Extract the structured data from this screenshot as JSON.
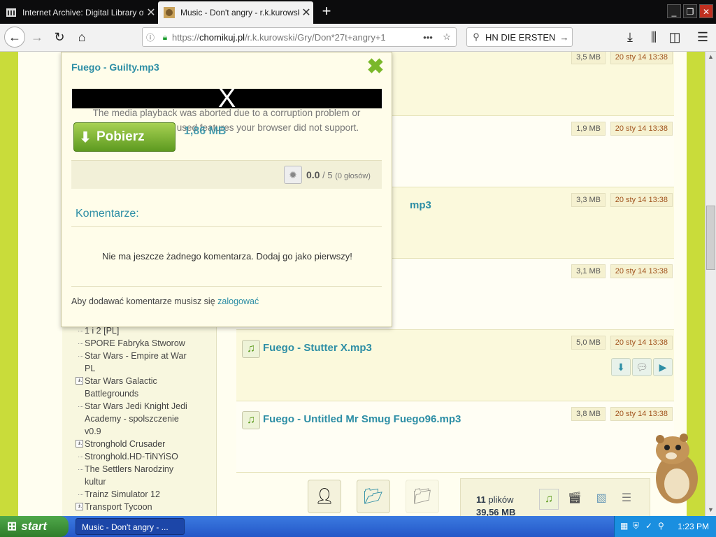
{
  "browser": {
    "tabs": [
      {
        "title": "Internet Archive: Digital Library of",
        "active": false
      },
      {
        "title": "Music - Don't angry - r.k.kurowski",
        "active": true
      }
    ],
    "new_tab": "+",
    "window_controls": {
      "minimize": "_",
      "restore": "❐",
      "close": "✕"
    },
    "url_domain": "chomikuj.pl",
    "url_rest": "/r.k.kurowski/Gry/Don*27t+angry+1",
    "url_prefix": "https://",
    "search_text": "HN DIE ERSTEN"
  },
  "files": [
    {
      "name": "",
      "size": "3,5 MB",
      "date": "20 sty 14 13:38"
    },
    {
      "name": "",
      "size": "1,9 MB",
      "date": "20 sty 14 13:38"
    },
    {
      "name": "mp3",
      "size": "3,3 MB",
      "date": "20 sty 14 13:38"
    },
    {
      "name": "",
      "size": "3,1 MB",
      "date": "20 sty 14 13:38"
    },
    {
      "name": "Fuego - Stutter X.mp3",
      "size": "5,0 MB",
      "date": "20 sty 14 13:38"
    },
    {
      "name": "Fuego - Untitled Mr Smug Fuego96.mp3",
      "size": "3,8 MB",
      "date": "20 sty 14 13:38"
    }
  ],
  "tree": [
    {
      "label": "1 i 2 [PL]",
      "plus": false
    },
    {
      "label": "SPORE Fabryka Stworow",
      "plus": false
    },
    {
      "label": "Star Wars - Empire at War PL",
      "plus": false
    },
    {
      "label": "Star Wars Galactic Battlegrounds",
      "plus": true
    },
    {
      "label": "Star Wars Jedi Knight Jedi Academy - spolszczenie v0.9",
      "plus": false
    },
    {
      "label": "Stronghold Crusader",
      "plus": true
    },
    {
      "label": "Stronghold.HD-TiNYiSO",
      "plus": false
    },
    {
      "label": "The Settlers Narodziny kultur",
      "plus": false
    },
    {
      "label": "Trainz Simulator 12",
      "plus": false
    },
    {
      "label": "Transport Tycoon",
      "plus": true
    }
  ],
  "stats": {
    "count": "11",
    "count_label": "plików",
    "size": "39,56 MB"
  },
  "popup": {
    "title": "Fuego - Guilty.mp3",
    "player_x": "X",
    "error": "The media playback was aborted due to a corruption problem or because the media used features your browser did not support.",
    "download_label": "Pobierz",
    "size": "1,86 MB",
    "rating": "0.0",
    "rating_max": "/ 5",
    "votes": "(0 głosów)",
    "comments_label": "Komentarze:",
    "no_comments": "Nie ma jeszcze żadnego komentarza. Dodaj go jako pierwszy!",
    "login_prefix": "Aby dodawać komentarze musisz się",
    "login_link": "zalogować"
  },
  "taskbar": {
    "start": "start",
    "app": "Music - Don't angry - ...",
    "clock": "1:23 PM"
  },
  "colors": {
    "accent": "#2d8ea5",
    "page_bg": "#c9dc3a",
    "download_green": "#7ab82a",
    "date": "#a0521c"
  }
}
